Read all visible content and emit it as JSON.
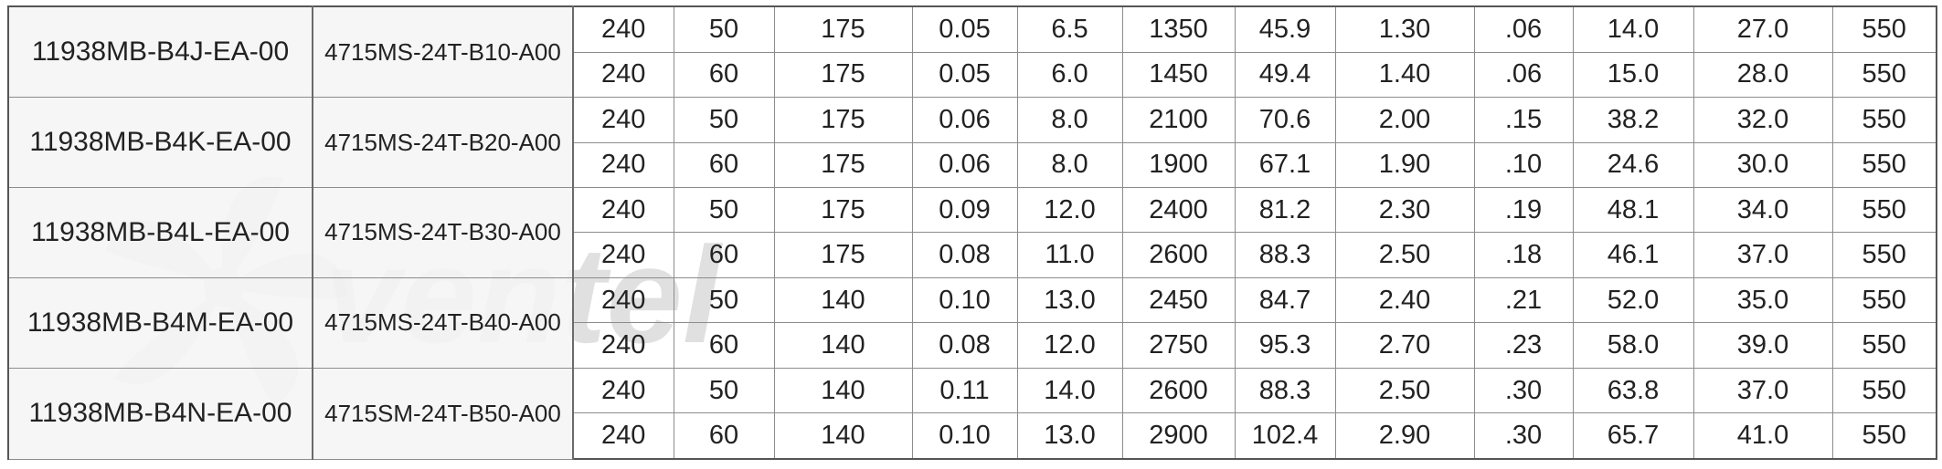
{
  "groups": [
    {
      "model": "11938MB-B4J-EA-00",
      "part": "4715MS-24T-B10-A00",
      "rows": [
        [
          "240",
          "50",
          "175",
          "0.05",
          "6.5",
          "1350",
          "45.9",
          "1.30",
          ".06",
          "14.0",
          "27.0",
          "550"
        ],
        [
          "240",
          "60",
          "175",
          "0.05",
          "6.0",
          "1450",
          "49.4",
          "1.40",
          ".06",
          "15.0",
          "28.0",
          "550"
        ]
      ]
    },
    {
      "model": "11938MB-B4K-EA-00",
      "part": "4715MS-24T-B20-A00",
      "rows": [
        [
          "240",
          "50",
          "175",
          "0.06",
          "8.0",
          "2100",
          "70.6",
          "2.00",
          ".15",
          "38.2",
          "32.0",
          "550"
        ],
        [
          "240",
          "60",
          "175",
          "0.06",
          "8.0",
          "1900",
          "67.1",
          "1.90",
          ".10",
          "24.6",
          "30.0",
          "550"
        ]
      ]
    },
    {
      "model": "11938MB-B4L-EA-00",
      "part": "4715MS-24T-B30-A00",
      "rows": [
        [
          "240",
          "50",
          "175",
          "0.09",
          "12.0",
          "2400",
          "81.2",
          "2.30",
          ".19",
          "48.1",
          "34.0",
          "550"
        ],
        [
          "240",
          "60",
          "175",
          "0.08",
          "11.0",
          "2600",
          "88.3",
          "2.50",
          ".18",
          "46.1",
          "37.0",
          "550"
        ]
      ]
    },
    {
      "model": "11938MB-B4M-EA-00",
      "part": "4715MS-24T-B40-A00",
      "rows": [
        [
          "240",
          "50",
          "140",
          "0.10",
          "13.0",
          "2450",
          "84.7",
          "2.40",
          ".21",
          "52.0",
          "35.0",
          "550"
        ],
        [
          "240",
          "60",
          "140",
          "0.08",
          "12.0",
          "2750",
          "95.3",
          "2.70",
          ".23",
          "58.0",
          "39.0",
          "550"
        ]
      ]
    },
    {
      "model": "11938MB-B4N-EA-00",
      "part": "4715SM-24T-B50-A00",
      "rows": [
        [
          "240",
          "50",
          "140",
          "0.11",
          "14.0",
          "2600",
          "88.3",
          "2.50",
          ".30",
          "63.8",
          "37.0",
          "550"
        ],
        [
          "240",
          "60",
          "140",
          "0.10",
          "13.0",
          "2900",
          "102.4",
          "2.90",
          ".30",
          "65.7",
          "41.0",
          "550"
        ]
      ]
    }
  ],
  "watermark": {
    "text": "ventel",
    "icon": "fan-icon",
    "color": "#b8b8b8"
  },
  "colors": {
    "grid": "#8c8c8c",
    "label_background": "#f4f4f4",
    "text": "#222222"
  }
}
